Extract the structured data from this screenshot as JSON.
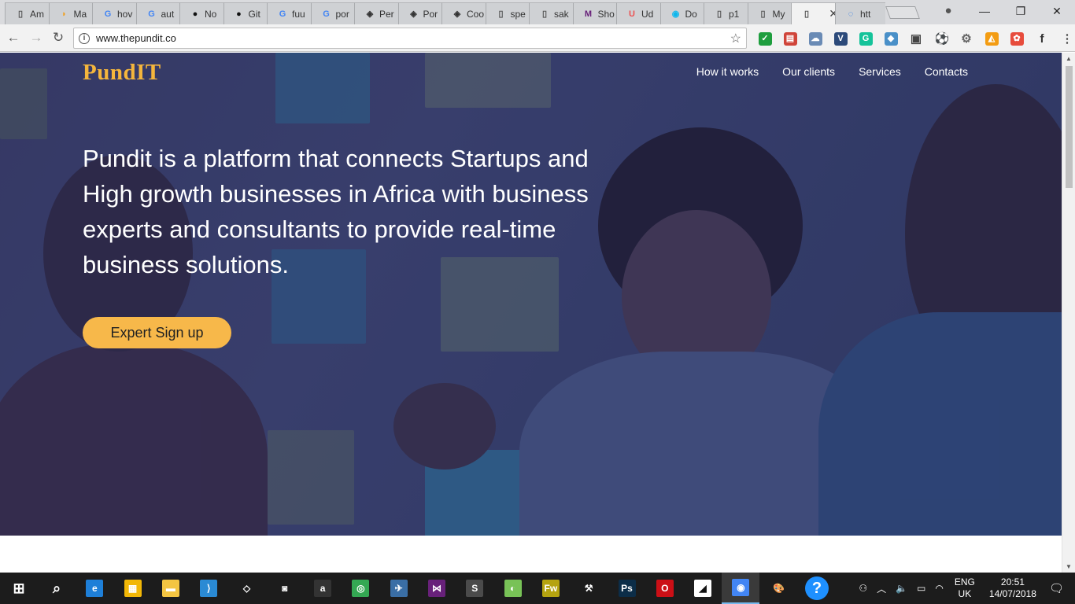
{
  "browser": {
    "tabs": [
      {
        "label": "Am",
        "icon": "page-icon"
      },
      {
        "label": "Ma",
        "icon": "mango-icon"
      },
      {
        "label": "hov",
        "icon": "google-icon"
      },
      {
        "label": "aut",
        "icon": "google-icon"
      },
      {
        "label": "No",
        "icon": "github-icon"
      },
      {
        "label": "Git",
        "icon": "github-icon"
      },
      {
        "label": "fuu",
        "icon": "google-icon"
      },
      {
        "label": "por",
        "icon": "google-icon"
      },
      {
        "label": "Per",
        "icon": "codepen-icon"
      },
      {
        "label": "Por",
        "icon": "codepen-icon"
      },
      {
        "label": "Coo",
        "icon": "codepen-icon"
      },
      {
        "label": "spe",
        "icon": "page-icon"
      },
      {
        "label": "sak",
        "icon": "page-icon"
      },
      {
        "label": "Sho",
        "icon": "visualstudio-icon"
      },
      {
        "label": "Ud",
        "icon": "udemy-icon"
      },
      {
        "label": "Do",
        "icon": "docker-icon"
      },
      {
        "label": "p1",
        "icon": "page-icon"
      },
      {
        "label": "My",
        "icon": "page-icon"
      },
      {
        "label": "",
        "icon": "page-icon",
        "active": true
      },
      {
        "label": "htt",
        "icon": "loading-icon"
      }
    ],
    "url": "www.thepundit.co",
    "extensions": [
      "check-icon",
      "pad-icon",
      "cloud-icon",
      "v-icon",
      "grammarly-icon",
      "pin-icon",
      "bus-icon",
      "soccer-icon",
      "gear-icon",
      "brave-icon",
      "color-wheel-icon",
      "font-icon",
      "menu-icon"
    ]
  },
  "site": {
    "brand": "PundIT",
    "nav": [
      "How it works",
      "Our clients",
      "Services",
      "Contacts"
    ],
    "headline": "Pundit is a platform that connects Startups and High growth businesses in Africa with business experts and consultants to provide real-time business solutions.",
    "cta": "Expert Sign up",
    "colors": {
      "brand": "#f5b63c",
      "cta": "#f7b84a",
      "overlay": "#2a2e5c"
    }
  },
  "taskbar": {
    "apps": [
      "start-icon",
      "search-icon",
      "edge-icon",
      "store-icon",
      "file-explorer-icon",
      "vscode-icon",
      "dropbox-icon",
      "camera-icon",
      "amazon-icon",
      "tripadvisor-icon",
      "skype-icon",
      "visualstudio-icon",
      "sublime-icon",
      "android-studio-icon",
      "fireworks-icon",
      "tools-icon",
      "photoshop-icon",
      "opera-icon",
      "sticky-notes-icon",
      "chrome-icon",
      "paint-icon",
      "help-icon"
    ],
    "lang_top": "ENG",
    "lang_bottom": "UK",
    "time": "20:51",
    "date": "14/07/2018"
  }
}
